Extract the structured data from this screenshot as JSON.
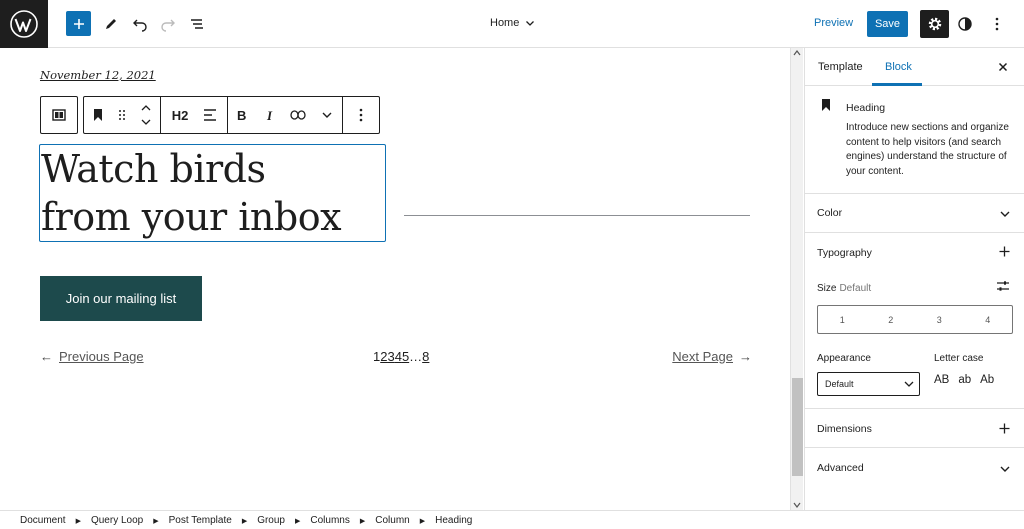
{
  "header": {
    "doc_title": "Home",
    "preview_label": "Preview",
    "save_label": "Save"
  },
  "canvas": {
    "post_date": "November 12, 2021",
    "block_toolbar": {
      "heading_level": "H2"
    },
    "heading_lines": [
      "Watch birds",
      "from your inbox"
    ],
    "button_label": "Join our mailing list",
    "pagination": {
      "prev_arrow": "←",
      "prev_label": "Previous Page",
      "pages": [
        "1",
        "2",
        "3",
        "4",
        "5"
      ],
      "current_page": "1",
      "ellipsis": "…",
      "last_page": "8",
      "next_label": "Next Page",
      "next_arrow": "→"
    }
  },
  "sidebar": {
    "tabs": {
      "template": "Template",
      "block": "Block"
    },
    "active_tab": "Block",
    "block_card": {
      "title": "Heading",
      "description": "Introduce new sections and organize content to help visitors (and search engines) understand the structure of your content."
    },
    "panels": {
      "color": "Color",
      "typography": "Typography",
      "dimensions": "Dimensions",
      "advanced": "Advanced"
    },
    "typography": {
      "size_label": "Size",
      "size_value": "Default",
      "size_options": [
        "1",
        "2",
        "3",
        "4"
      ],
      "appearance_label": "Appearance",
      "appearance_value": "Default",
      "letter_case_label": "Letter case",
      "letter_case_options": [
        "AB",
        "ab",
        "Ab"
      ]
    }
  },
  "breadcrumb": [
    "Document",
    "Query Loop",
    "Post Template",
    "Group",
    "Columns",
    "Column",
    "Heading"
  ],
  "colors": {
    "accent": "#0e71b4",
    "button_bg": "#1d4a4c",
    "dark": "#1e1e1e"
  }
}
